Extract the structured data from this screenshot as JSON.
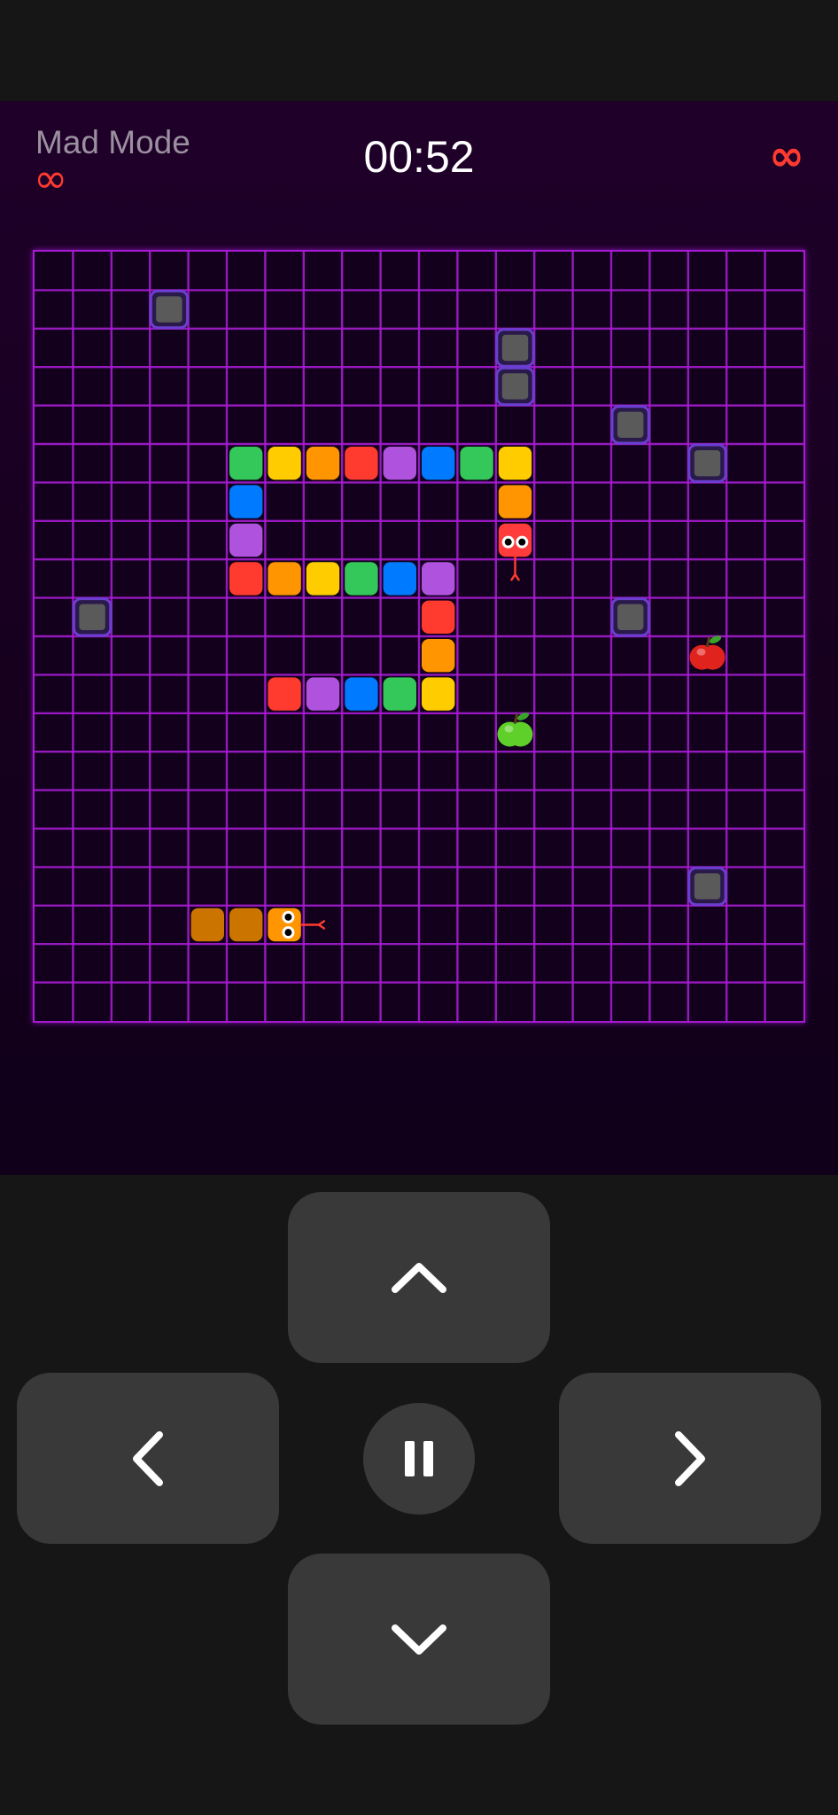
{
  "header": {
    "mode_title": "Mad Mode",
    "mode_infinity": "∞",
    "timer": "00:52",
    "lives": "∞"
  },
  "board": {
    "cols": 20,
    "rows": 20,
    "grid_color": "#a51cd0",
    "background": "#12001c",
    "obstacles": [
      [
        3,
        1
      ],
      [
        12,
        2
      ],
      [
        12,
        3
      ],
      [
        15,
        4
      ],
      [
        17,
        5
      ],
      [
        1,
        9
      ],
      [
        15,
        9
      ],
      [
        17,
        16
      ]
    ],
    "snakes": [
      {
        "name": "rainbow-snake",
        "head_color": "#ff3b3b",
        "tongue_dir": "down",
        "segments": [
          {
            "c": 12,
            "r": 7,
            "color": "#ff3b3b"
          },
          {
            "c": 12,
            "r": 6,
            "color": "#ff9500"
          },
          {
            "c": 12,
            "r": 5,
            "color": "#ffcc00"
          },
          {
            "c": 11,
            "r": 5,
            "color": "#34c759"
          },
          {
            "c": 10,
            "r": 5,
            "color": "#007aff"
          },
          {
            "c": 9,
            "r": 5,
            "color": "#af52de"
          },
          {
            "c": 8,
            "r": 5,
            "color": "#ff3b30"
          },
          {
            "c": 7,
            "r": 5,
            "color": "#ff9500"
          },
          {
            "c": 6,
            "r": 5,
            "color": "#ffcc00"
          },
          {
            "c": 5,
            "r": 5,
            "color": "#34c759"
          },
          {
            "c": 5,
            "r": 6,
            "color": "#007aff"
          },
          {
            "c": 5,
            "r": 7,
            "color": "#af52de"
          },
          {
            "c": 5,
            "r": 8,
            "color": "#ff3b30"
          },
          {
            "c": 6,
            "r": 8,
            "color": "#ff9500"
          },
          {
            "c": 7,
            "r": 8,
            "color": "#ffcc00"
          },
          {
            "c": 8,
            "r": 8,
            "color": "#34c759"
          },
          {
            "c": 9,
            "r": 8,
            "color": "#007aff"
          },
          {
            "c": 10,
            "r": 8,
            "color": "#af52de"
          },
          {
            "c": 10,
            "r": 9,
            "color": "#ff3b30"
          },
          {
            "c": 10,
            "r": 10,
            "color": "#ff9500"
          },
          {
            "c": 10,
            "r": 11,
            "color": "#ffcc00"
          },
          {
            "c": 9,
            "r": 11,
            "color": "#34c759"
          },
          {
            "c": 8,
            "r": 11,
            "color": "#007aff"
          },
          {
            "c": 7,
            "r": 11,
            "color": "#af52de"
          },
          {
            "c": 6,
            "r": 11,
            "color": "#ff3b30"
          }
        ]
      },
      {
        "name": "orange-snake",
        "head_color": "#ff9500",
        "tongue_dir": "right",
        "segments": [
          {
            "c": 6,
            "r": 17,
            "color": "#ff9500"
          },
          {
            "c": 5,
            "r": 17,
            "color": "#cc7400"
          },
          {
            "c": 4,
            "r": 17,
            "color": "#cc7400"
          }
        ]
      }
    ],
    "fruits": [
      {
        "name": "red-apple",
        "c": 17,
        "r": 10,
        "color": "#e0231c"
      },
      {
        "name": "green-apple",
        "c": 12,
        "r": 12,
        "color": "#5fcf2a"
      }
    ]
  },
  "controls": {
    "up": "chevron-up-icon",
    "down": "chevron-down-icon",
    "left": "chevron-left-icon",
    "right": "chevron-right-icon",
    "pause": "pause-icon"
  }
}
